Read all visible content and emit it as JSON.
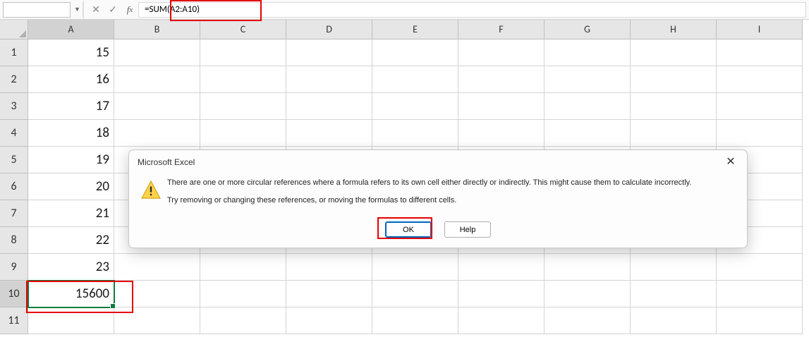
{
  "formula_bar": {
    "name_box": "",
    "formula": "=SUM(A2:A10)"
  },
  "columns": [
    "A",
    "B",
    "C",
    "D",
    "E",
    "F",
    "G",
    "H",
    "I"
  ],
  "row_count": 11,
  "active_col_index": 0,
  "active_row_index": 9,
  "cells_col_A": [
    "15",
    "16",
    "17",
    "18",
    "19",
    "20",
    "21",
    "22",
    "23",
    "15600",
    ""
  ],
  "selected_cell": "A10",
  "dialog": {
    "title": "Microsoft Excel",
    "line1": "There are one or more circular references where a formula refers to its own cell either directly or indirectly. This might cause them to calculate incorrectly.",
    "line2": "Try removing or changing these references, or moving the formulas to different cells.",
    "ok_label": "OK",
    "help_label": "Help"
  }
}
